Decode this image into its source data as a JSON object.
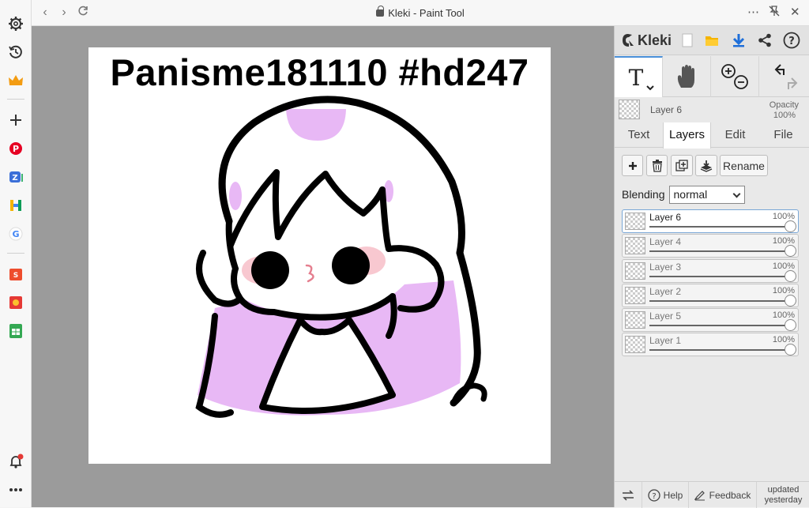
{
  "window": {
    "title": "Kleki - Paint Tool"
  },
  "browser_sidebar": {
    "icons": [
      "settings-icon",
      "history-icon",
      "crown-icon",
      "add-icon",
      "pinterest-icon",
      "translate-icon",
      "h-app-icon",
      "google-icon",
      "shopee-icon",
      "coupon-icon",
      "sheets-icon",
      "bell-icon",
      "more-icon"
    ]
  },
  "canvas": {
    "text": "Panisme181110 #hd247"
  },
  "panel": {
    "logo": "Kleki",
    "current_layer": {
      "name": "Layer 6",
      "opacity_label": "Opacity",
      "opacity_value": "100%"
    },
    "tabs": [
      "Text",
      "Layers",
      "Edit",
      "File"
    ],
    "buttons": {
      "rename": "Rename"
    },
    "blending": {
      "label": "Blending",
      "value": "normal"
    },
    "layers": [
      {
        "name": "Layer 6",
        "opacity": "100%",
        "level": 1.0
      },
      {
        "name": "Layer 4",
        "opacity": "100%",
        "level": 1.0
      },
      {
        "name": "Layer 3",
        "opacity": "100%",
        "level": 1.0
      },
      {
        "name": "Layer 2",
        "opacity": "100%",
        "level": 1.0
      },
      {
        "name": "Layer 5",
        "opacity": "100%",
        "level": 1.0
      },
      {
        "name": "Layer 1",
        "opacity": "100%",
        "level": 1.0
      }
    ],
    "footer": {
      "help": "Help",
      "feedback": "Feedback",
      "updated": "updated",
      "updated_when": "yesterday"
    }
  },
  "colors": {
    "accent": "#4a90d9",
    "lilac": "#e8b8f5",
    "blush": "#f8c8d0"
  }
}
